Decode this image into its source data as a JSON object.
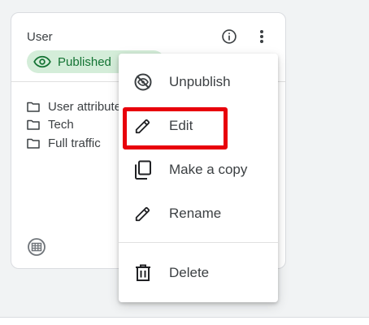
{
  "card": {
    "title": "User",
    "status_badge": "Published",
    "folders": [
      {
        "label": "User attributes"
      },
      {
        "label": "Tech"
      },
      {
        "label": "Full traffic"
      }
    ]
  },
  "menu": {
    "items": [
      {
        "label": "Unpublish",
        "icon": "unpublish-icon"
      },
      {
        "label": "Edit",
        "icon": "pencil-icon"
      },
      {
        "label": "Make a copy",
        "icon": "copy-icon"
      },
      {
        "label": "Rename",
        "icon": "pencil-icon"
      },
      {
        "label": "Delete",
        "icon": "trash-icon"
      }
    ],
    "highlighted_item": "Edit"
  },
  "colors": {
    "badge_bg": "#d4edd9",
    "badge_text": "#137333",
    "highlight": "#e8000b",
    "text": "#3c4043"
  }
}
